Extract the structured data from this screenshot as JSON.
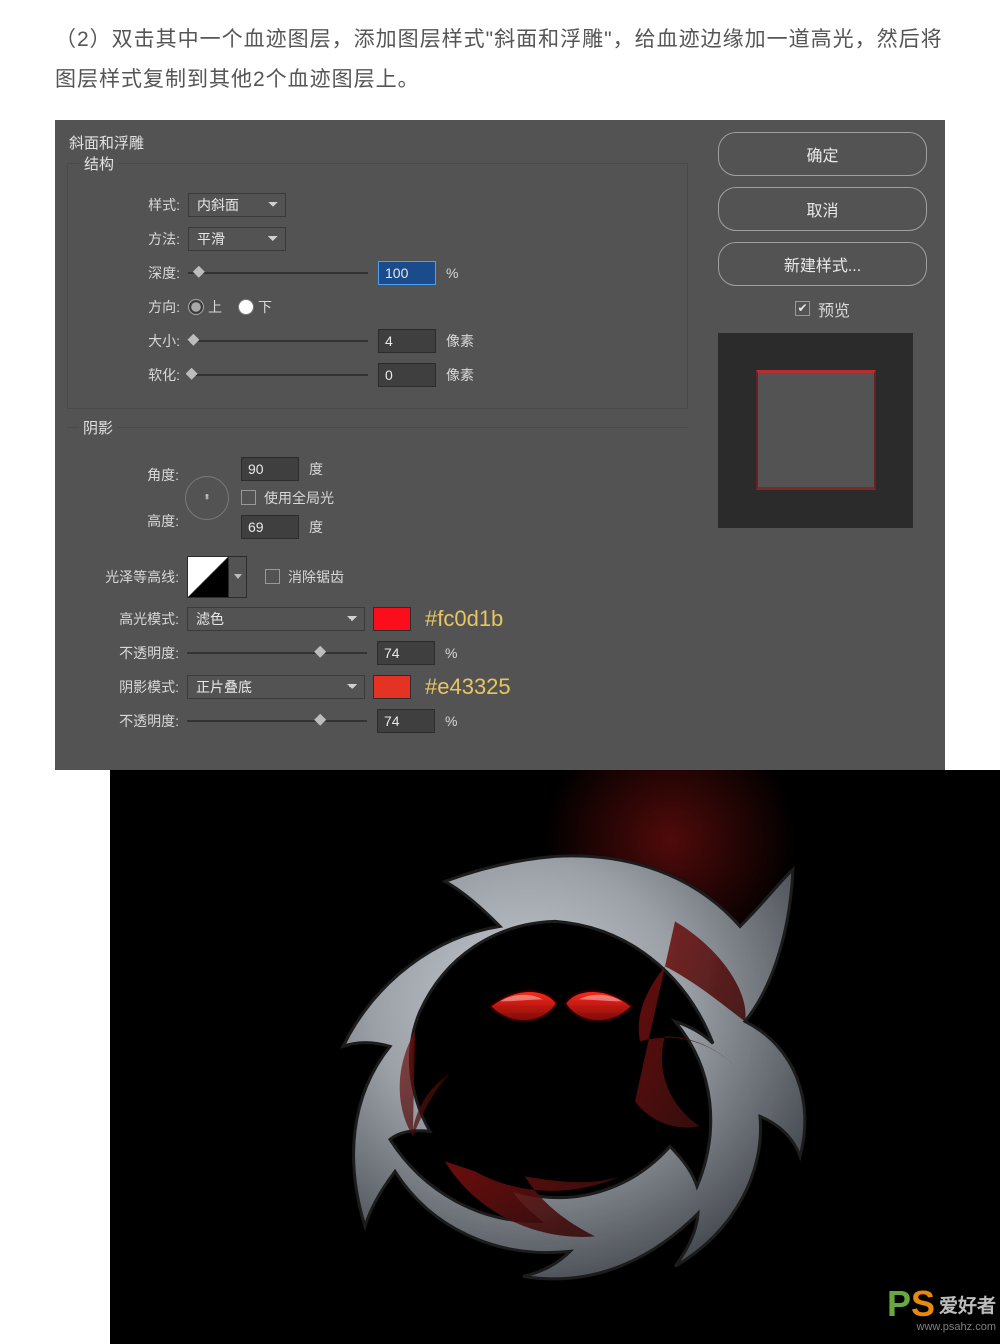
{
  "instruction": "（2）双击其中一个血迹图层，添加图层样式\"斜面和浮雕\"，给血迹边缘加一道高光，然后将图层样式复制到其他2个血迹图层上。",
  "panel": {
    "title": "斜面和浮雕",
    "structure": {
      "legend": "结构",
      "style_label": "样式:",
      "style_value": "内斜面",
      "technique_label": "方法:",
      "technique_value": "平滑",
      "depth_label": "深度:",
      "depth_value": "100",
      "depth_unit": "%",
      "direction_label": "方向:",
      "direction_up": "上",
      "direction_down": "下",
      "size_label": "大小:",
      "size_value": "4",
      "size_unit": "像素",
      "soften_label": "软化:",
      "soften_value": "0",
      "soften_unit": "像素"
    },
    "shading": {
      "legend": "阴影",
      "angle_label": "角度:",
      "angle_value": "90",
      "angle_unit": "度",
      "global_light_label": "使用全局光",
      "altitude_label": "高度:",
      "altitude_value": "69",
      "altitude_unit": "度",
      "contour_label": "光泽等高线:",
      "antialias_label": "消除锯齿",
      "highlight_mode_label": "高光模式:",
      "highlight_mode_value": "滤色",
      "highlight_hex": "#fc0d1b",
      "highlight_opacity_label": "不透明度:",
      "highlight_opacity_value": "74",
      "highlight_opacity_unit": "%",
      "shadow_mode_label": "阴影模式:",
      "shadow_mode_value": "正片叠底",
      "shadow_hex": "#e43325",
      "shadow_opacity_label": "不透明度:",
      "shadow_opacity_value": "74",
      "shadow_opacity_unit": "%"
    },
    "buttons": {
      "ok": "确定",
      "cancel": "取消",
      "new_style": "新建样式...",
      "preview": "预览"
    }
  },
  "watermark": {
    "cn": "爱好者",
    "url": "www.psahz.com"
  }
}
